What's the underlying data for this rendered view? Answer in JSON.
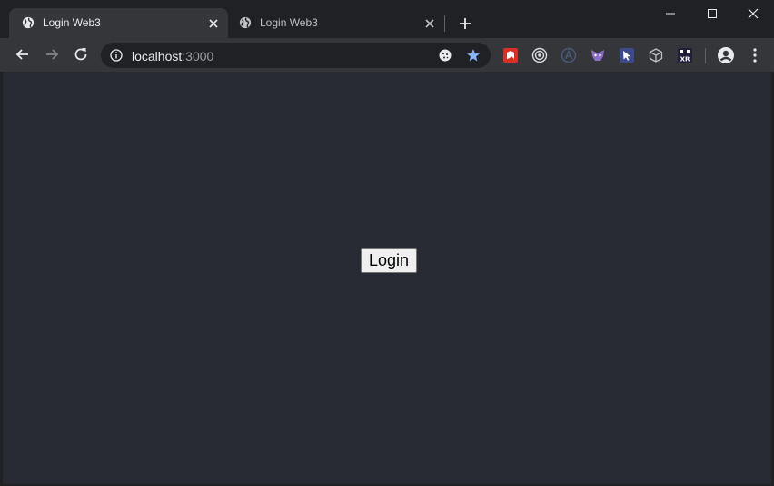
{
  "tabs": [
    {
      "title": "Login Web3",
      "active": true
    },
    {
      "title": "Login Web3",
      "active": false
    }
  ],
  "omnibox": {
    "host": "localhost",
    "port": ":3000"
  },
  "extensions": [
    "red-extension-icon",
    "target-icon",
    "a-circle-icon",
    "fox-icon",
    "cursor-icon",
    "cube-icon",
    "xr-icon"
  ],
  "page": {
    "login_label": "Login"
  },
  "colors": {
    "tabstrip": "#202124",
    "toolbar": "#35363a",
    "page_background": "#282a33",
    "star": "#8ab4f8"
  }
}
